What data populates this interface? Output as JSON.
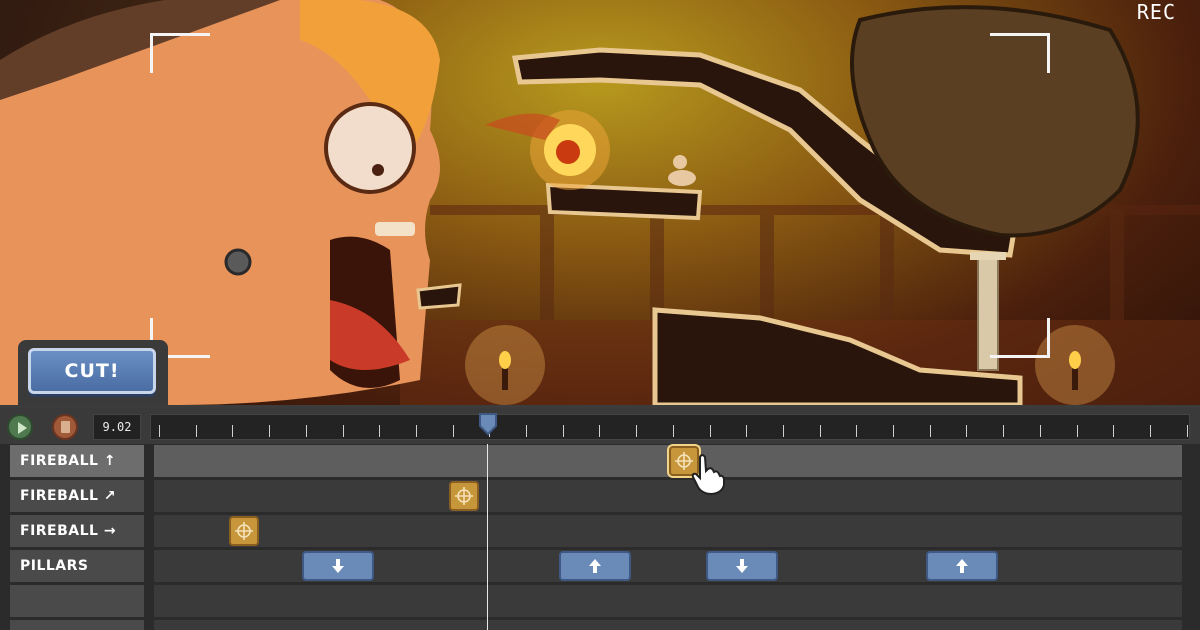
{
  "viewport": {
    "rec_label": "REC",
    "cut_button_label": "CUT!"
  },
  "timeline": {
    "time_display": "9.02",
    "playhead_time": 9.02,
    "tracks": [
      {
        "label": "FIREBALL ↑",
        "active": true
      },
      {
        "label": "FIREBALL ↗",
        "active": false
      },
      {
        "label": "FIREBALL →",
        "active": false
      },
      {
        "label": "PILLARS",
        "active": false
      },
      {
        "label": "",
        "active": false
      },
      {
        "label": "",
        "active": false
      }
    ],
    "keyframes": {
      "fireball_up": [
        {
          "icon": "crosshair-icon",
          "selected": true
        }
      ],
      "fireball_diag": [
        {
          "icon": "crosshair-icon",
          "selected": false
        }
      ],
      "fireball_right": [
        {
          "icon": "crosshair-icon",
          "selected": false
        }
      ],
      "pillars": [
        {
          "icon": "arrow-down-icon"
        },
        {
          "icon": "arrow-up-icon"
        },
        {
          "icon": "arrow-down-icon"
        },
        {
          "icon": "arrow-up-icon"
        }
      ]
    }
  },
  "colors": {
    "fireball_key": "#c8963a",
    "pillar_key": "#6a8bb8",
    "cut_button": "#5a7fb5"
  }
}
